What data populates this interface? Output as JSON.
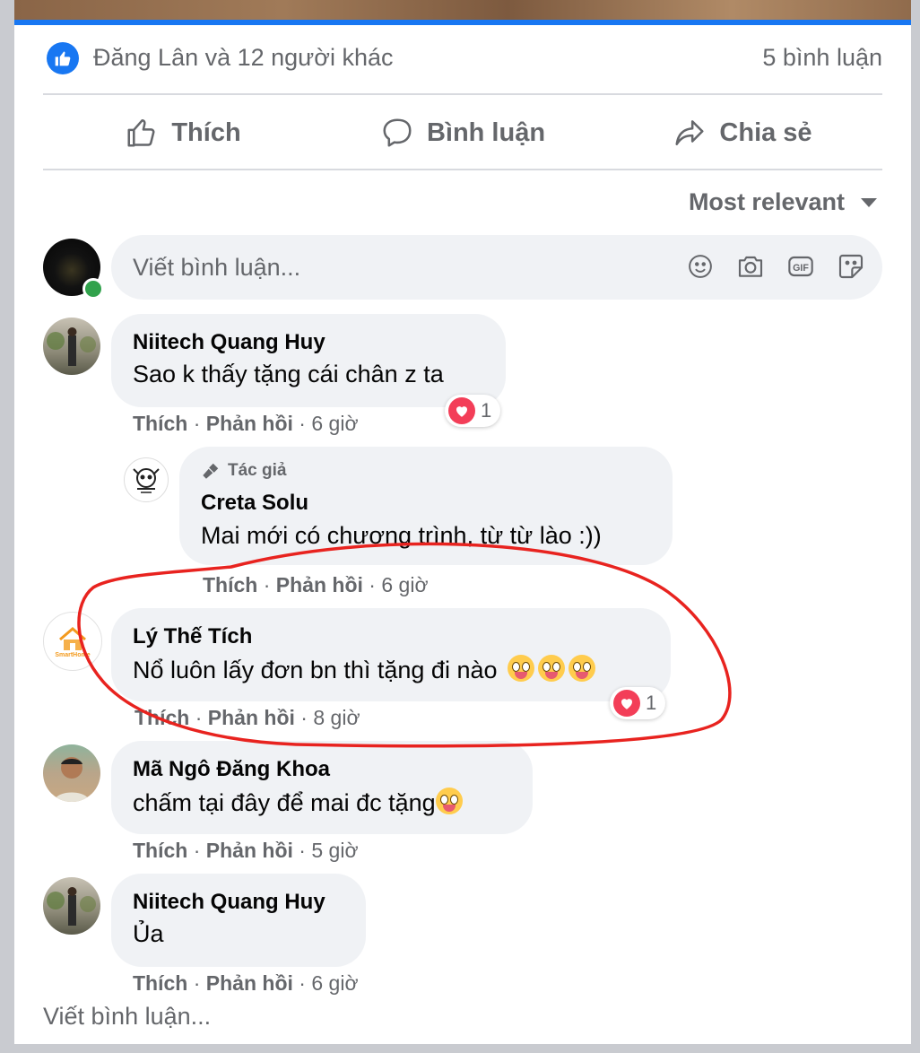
{
  "summary": {
    "reactors": "Đăng Lân và 12 người khác",
    "comment_count": "5 bình luận"
  },
  "actions": {
    "like": "Thích",
    "comment": "Bình luận",
    "share": "Chia sẻ"
  },
  "sort": {
    "label": "Most relevant"
  },
  "composer": {
    "placeholder": "Viết bình luận..."
  },
  "comments": [
    {
      "author": "Niitech Quang Huy",
      "text": "Sao k thấy tặng cái chân z ta",
      "like": "Thích",
      "reply": "Phản hồi",
      "time": "6 giờ",
      "reaction_count": "1",
      "reply_item": {
        "badge": "Tác giả",
        "author": "Creta Solu",
        "text": "Mai mới có chương trình, từ từ lào :))",
        "like": "Thích",
        "reply": "Phản hồi",
        "time": "6 giờ"
      }
    },
    {
      "author": "Lý Thế Tích",
      "text": "Nổ luôn lấy đơn bn thì tặng đi nào",
      "like": "Thích",
      "reply": "Phản hồi",
      "time": "8 giờ",
      "reaction_count": "1",
      "avatar_text": "SmartHome"
    },
    {
      "author": "Mã Ngô Đăng Khoa",
      "text": "chấm tại đây để mai đc tặng",
      "like": "Thích",
      "reply": "Phản hồi",
      "time": "5 giờ"
    },
    {
      "author": "Niitech Quang Huy",
      "text": "Ủa",
      "like": "Thích",
      "reply": "Phản hồi",
      "time": "6 giờ"
    }
  ],
  "footer": {
    "placeholder": "Viết bình luận..."
  },
  "colors": {
    "accent": "#1877f2",
    "annotation": "#e8231f",
    "heart": "#f33e58",
    "online": "#31a24c"
  }
}
